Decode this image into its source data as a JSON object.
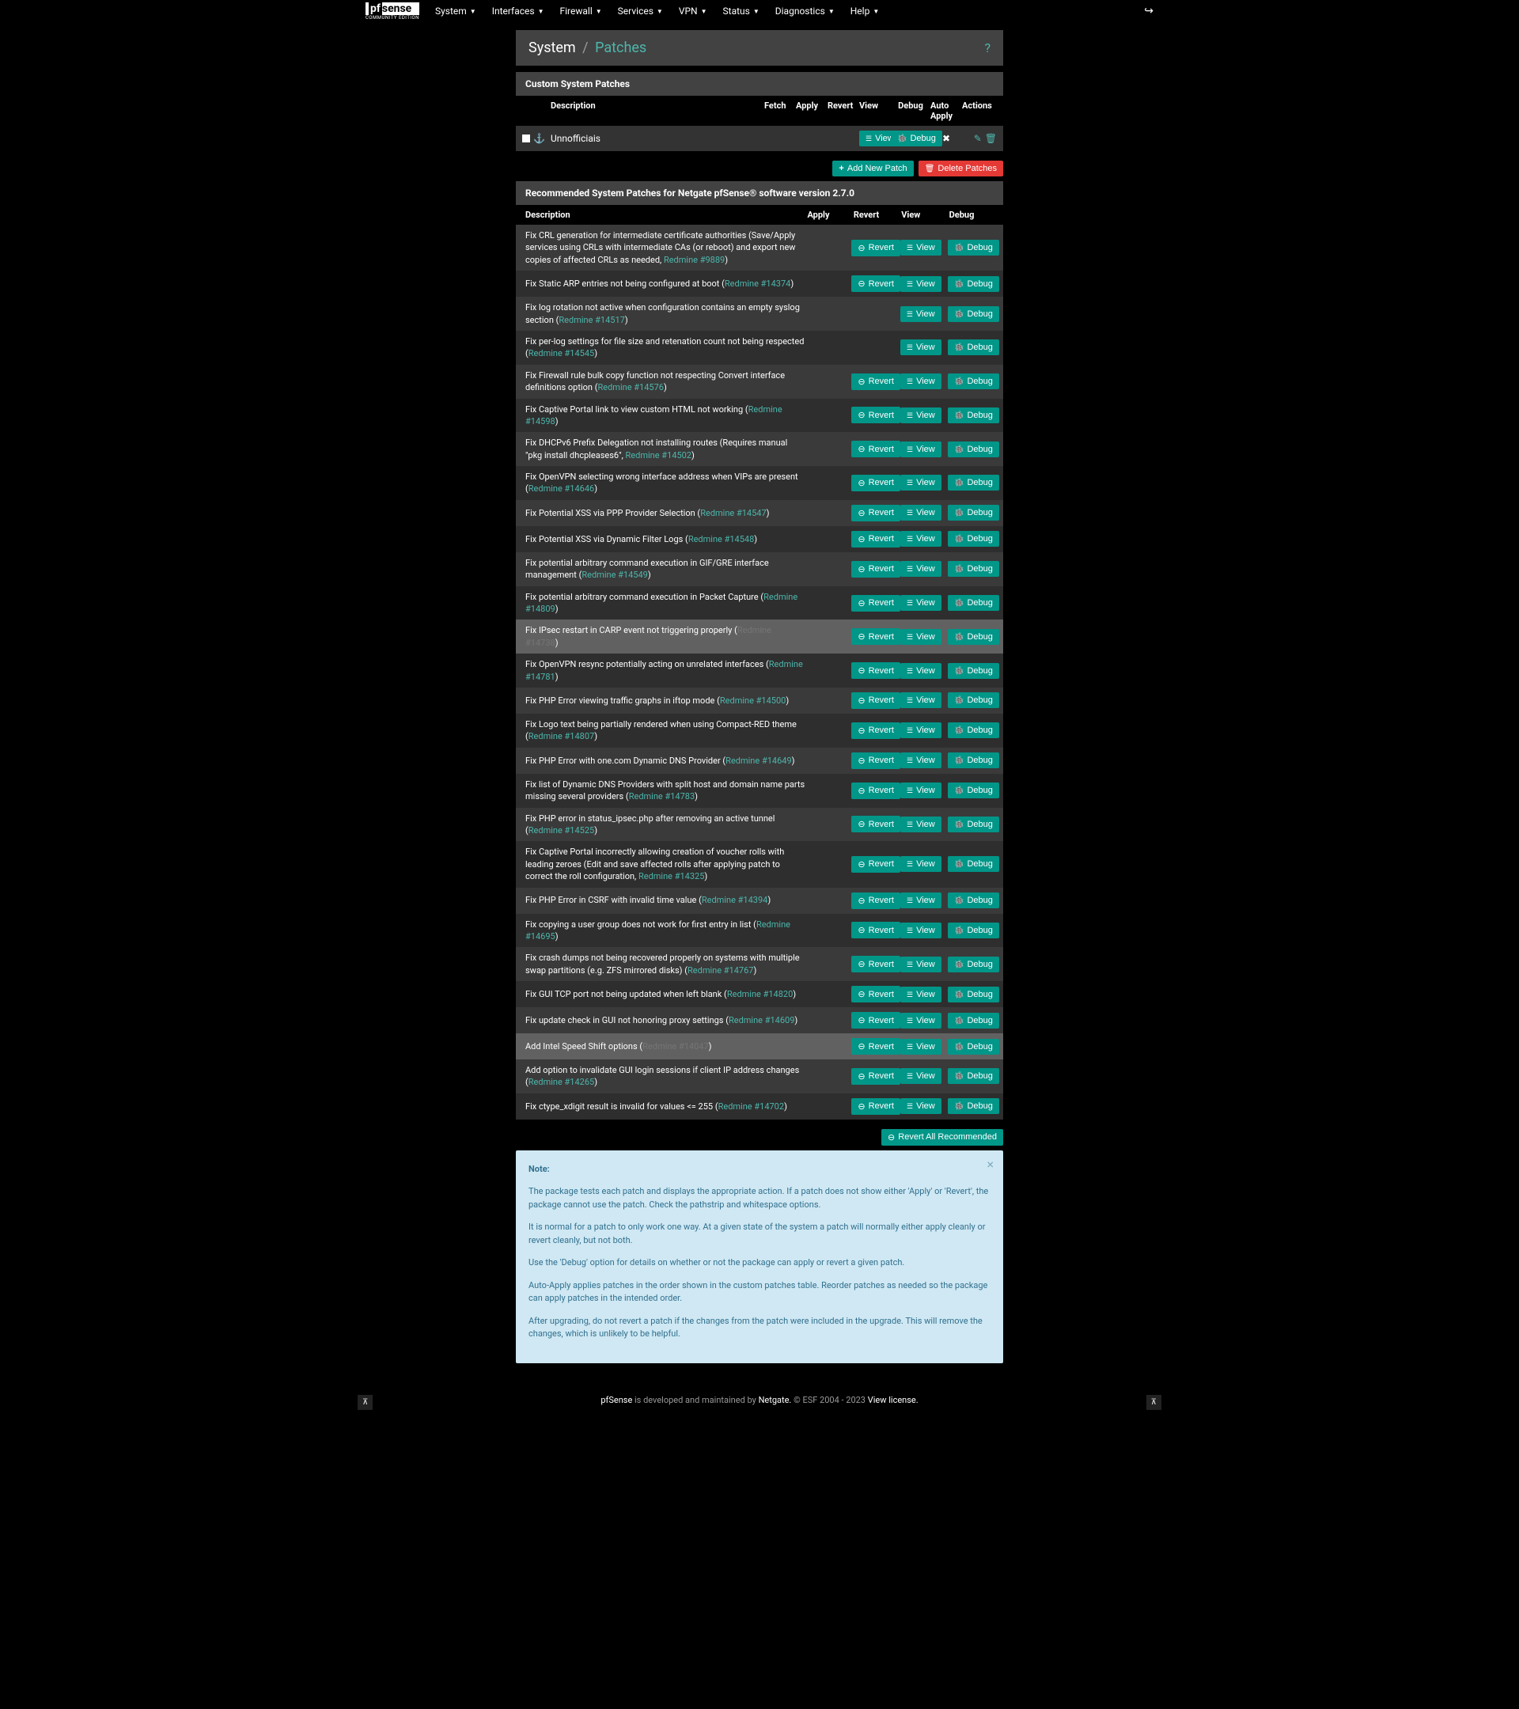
{
  "nav": {
    "items": [
      "System",
      "Interfaces",
      "Firewall",
      "Services",
      "VPN",
      "Status",
      "Diagnostics",
      "Help"
    ],
    "logo_main_pf": "pf",
    "logo_main_sense": "sense",
    "logo_sub": "COMMUNITY EDITION"
  },
  "breadcrumb": {
    "root": "System",
    "current": "Patches"
  },
  "custom_panel": {
    "title": "Custom System Patches",
    "headers": [
      "Description",
      "Fetch",
      "Apply",
      "Revert",
      "View",
      "Debug",
      "Auto Apply",
      "Actions"
    ],
    "rows": [
      {
        "desc": "Unnofficiais"
      }
    ]
  },
  "buttons": {
    "view": "View",
    "debug": "Debug",
    "revert": "Revert",
    "add_new": "Add New Patch",
    "delete_patches": "Delete Patches",
    "revert_all": "Revert All Recommended"
  },
  "rec_panel": {
    "title": "Recommended System Patches for Netgate pfSense® software version 2.7.0",
    "headers": [
      "Description",
      "Apply",
      "Revert",
      "View",
      "Debug"
    ],
    "patches": [
      {
        "desc": "Fix CRL generation for intermediate certificate authorities (Save/Apply services using CRLs with intermediate CAs (or reboot) and export new copies of affected CRLs as needed, ",
        "link": "Redmine #9889",
        "link_class": "",
        "suffix": ")",
        "show_revert": true
      },
      {
        "desc": "Fix Static ARP entries not being configured at boot (",
        "link": "Redmine #14374",
        "link_class": "",
        "suffix": ")",
        "show_revert": true
      },
      {
        "desc": "Fix log rotation not active when configuration contains an empty syslog section (",
        "link": "Redmine #14517",
        "link_class": "",
        "suffix": ")",
        "show_revert": false
      },
      {
        "desc": "Fix per-log settings for file size and retenation count not being respected (",
        "link": "Redmine #14545",
        "link_class": "",
        "suffix": ")",
        "show_revert": false
      },
      {
        "desc": "Fix Firewall rule bulk copy function not respecting Convert interface definitions option (",
        "link": "Redmine #14576",
        "link_class": "",
        "suffix": ")",
        "show_revert": true
      },
      {
        "desc": "Fix Captive Portal link to view custom HTML not working (",
        "link": "Redmine #14598",
        "link_class": "",
        "suffix": ")",
        "show_revert": true
      },
      {
        "desc": "Fix DHCPv6 Prefix Delegation not installing routes (Requires manual \"pkg install dhcpleases6\", ",
        "link": "Redmine #14502",
        "link_class": "",
        "suffix": ")",
        "show_revert": true
      },
      {
        "desc": "Fix OpenVPN selecting wrong interface address when VIPs are present (",
        "link": "Redmine #14646",
        "link_class": "",
        "suffix": ")",
        "show_revert": true
      },
      {
        "desc": "Fix Potential XSS via PPP Provider Selection (",
        "link": "Redmine #14547",
        "link_class": "",
        "suffix": ")",
        "show_revert": true
      },
      {
        "desc": "Fix Potential XSS via Dynamic Filter Logs (",
        "link": "Redmine #14548",
        "link_class": "",
        "suffix": ")",
        "show_revert": true
      },
      {
        "desc": "Fix potential arbitrary command execution in GIF/GRE interface management (",
        "link": "Redmine #14549",
        "link_class": "",
        "suffix": ")",
        "show_revert": true
      },
      {
        "desc": "Fix potential arbitrary command execution in Packet Capture (",
        "link": "Redmine #14809",
        "link_class": "",
        "suffix": ")",
        "show_revert": true
      },
      {
        "desc": "Fix IPsec restart in CARP event not triggering properly (",
        "link": "Redmine #14738",
        "link_class": "visited",
        "suffix": ")",
        "show_revert": true,
        "highlight": true
      },
      {
        "desc": "Fix OpenVPN resync potentially acting on unrelated interfaces (",
        "link": "Redmine #14781",
        "link_class": "",
        "suffix": ")",
        "show_revert": true
      },
      {
        "desc": "Fix PHP Error viewing traffic graphs in iftop mode (",
        "link": "Redmine #14500",
        "link_class": "",
        "suffix": ")",
        "show_revert": true
      },
      {
        "desc": "Fix Logo text being partially rendered when using Compact-RED theme (",
        "link": "Redmine #14807",
        "link_class": "",
        "suffix": ")",
        "show_revert": true
      },
      {
        "desc": "Fix PHP Error with one.com Dynamic DNS Provider (",
        "link": "Redmine #14649",
        "link_class": "",
        "suffix": ")",
        "show_revert": true
      },
      {
        "desc": "Fix list of Dynamic DNS Providers with split host and domain name parts missing several providers (",
        "link": "Redmine #14783",
        "link_class": "",
        "suffix": ")",
        "show_revert": true
      },
      {
        "desc": "Fix PHP error in status_ipsec.php after removing an active tunnel (",
        "link": "Redmine #14525",
        "link_class": "",
        "suffix": ")",
        "show_revert": true
      },
      {
        "desc": "Fix Captive Portal incorrectly allowing creation of voucher rolls with leading zeroes (Edit and save affected rolls after applying patch to correct the roll configuration, ",
        "link": "Redmine #14325",
        "link_class": "",
        "suffix": ")",
        "show_revert": true
      },
      {
        "desc": "Fix PHP Error in CSRF with invalid time value (",
        "link": "Redmine #14394",
        "link_class": "",
        "suffix": ")",
        "show_revert": true
      },
      {
        "desc": "Fix copying a user group does not work for first entry in list (",
        "link": "Redmine #14695",
        "link_class": "",
        "suffix": ")",
        "show_revert": true
      },
      {
        "desc": "Fix crash dumps not being recovered properly on systems with multiple swap partitions (e.g. ZFS mirrored disks) (",
        "link": "Redmine #14767",
        "link_class": "",
        "suffix": ")",
        "show_revert": true
      },
      {
        "desc": "Fix GUI TCP port not being updated when left blank (",
        "link": "Redmine #14820",
        "link_class": "",
        "suffix": ")",
        "show_revert": true
      },
      {
        "desc": "Fix update check in GUI not honoring proxy settings (",
        "link": "Redmine #14609",
        "link_class": "",
        "suffix": ")",
        "show_revert": true
      },
      {
        "desc": "Add Intel Speed Shift options (",
        "link": "Redmine #14047",
        "link_class": "visited",
        "suffix": ")",
        "show_revert": true,
        "highlight": true
      },
      {
        "desc": "Add option to invalidate GUI login sessions if client IP address changes (",
        "link": "Redmine #14265",
        "link_class": "",
        "suffix": ")",
        "show_revert": true
      },
      {
        "desc": "Fix ctype_xdigit result is invalid for values <= 255 (",
        "link": "Redmine #14702",
        "link_class": "",
        "suffix": ")",
        "show_revert": true
      }
    ]
  },
  "note": {
    "title": "Note:",
    "p1": "The package tests each patch and displays the appropriate action. If a patch does not show either 'Apply' or 'Revert', the package cannot use the patch. Check the pathstrip and whitespace options.",
    "p2": "It is normal for a patch to only work one way. At a given state of the system a patch will normally either apply cleanly or revert cleanly, but not both.",
    "p3": "Use the 'Debug' option for details on whether or not the package can apply or revert a given patch.",
    "p4": "Auto-Apply applies patches in the order shown in the custom patches table. Reorder patches as needed so the package can apply patches in the intended order.",
    "p5": "After upgrading, do not revert a patch if the changes from the patch were included in the upgrade. This will remove the changes, which is unlikely to be helpful."
  },
  "footer": {
    "text_pre": "pfSense",
    "text_mid": " is developed and maintained by ",
    "netgate": "Netgate.",
    "copyright": " © ESF 2004 - 2023 ",
    "license": "View license."
  }
}
